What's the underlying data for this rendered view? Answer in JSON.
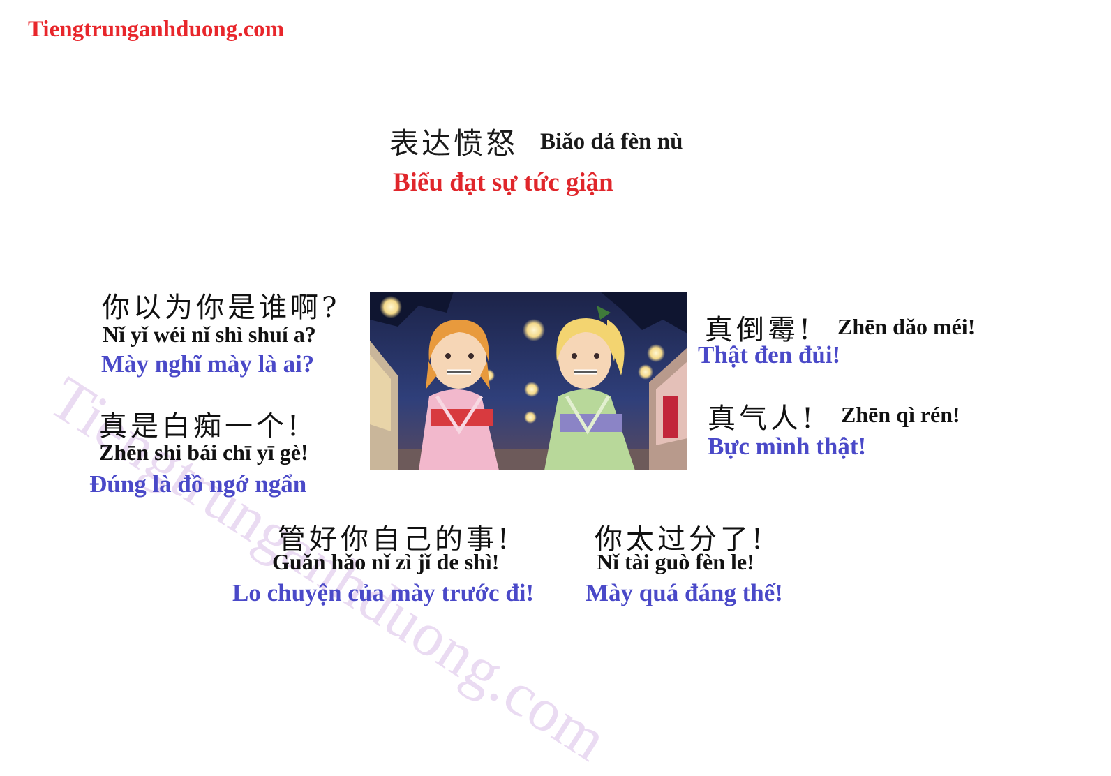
{
  "site": {
    "name": "Tiengtrunganhduong.com"
  },
  "header": {
    "chinese": "表达愤怒",
    "pinyin": "Biǎo dá fèn nù",
    "vietnamese": "Biểu đạt sự tức giận"
  },
  "phrases": [
    {
      "chinese": "你以为你是谁啊?",
      "pinyin": "Nǐ yǐ wéi nǐ shì shuí a?",
      "vietnamese": "Mày nghĩ mày là ai?"
    },
    {
      "chinese": "真是白痴一个!",
      "pinyin": "Zhēn shi bái chī yī gè!",
      "vietnamese": "Đúng là đồ ngớ ngẩn"
    },
    {
      "chinese": "真倒霉!",
      "pinyin": "Zhēn dǎo méi!",
      "vietnamese": "Thật đen đủi!"
    },
    {
      "chinese": "真气人!",
      "pinyin": "Zhēn qì rén!",
      "vietnamese": "Bực mình thật!"
    },
    {
      "chinese": "管好你自己的事!",
      "pinyin": "Guǎn hǎo nǐ zì jǐ de shì!",
      "vietnamese": "Lo chuyện của mày trước đi!"
    },
    {
      "chinese": "你太过分了!",
      "pinyin": "Nǐ tài guò fèn le!",
      "vietnamese": "Mày quá đáng thế!"
    }
  ],
  "watermark": {
    "text": "Tiengtrunganhduong.com"
  },
  "illustration": {
    "icon": "anime-girls-festival-illustration"
  },
  "colors": {
    "brand_red": "#e8262b",
    "phrase_blue": "#4a49c8",
    "text_black": "#111111",
    "watermark_lavender": "#cdaae1"
  }
}
